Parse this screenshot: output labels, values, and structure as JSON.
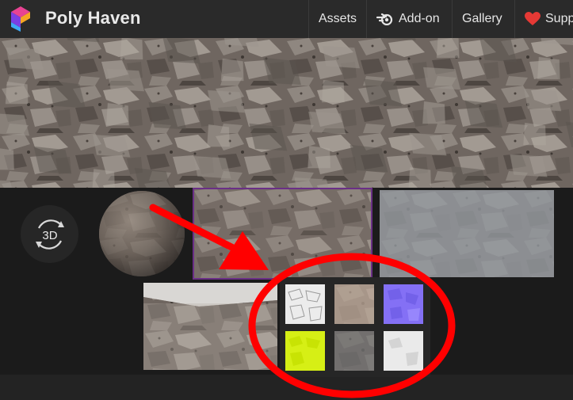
{
  "header": {
    "brand": "Poly Haven",
    "nav": [
      {
        "label": "Assets",
        "icon": ""
      },
      {
        "label": "Add-on",
        "icon": "blender-icon"
      },
      {
        "label": "Gallery",
        "icon": ""
      },
      {
        "label": "Supp",
        "icon": "heart-icon"
      }
    ]
  },
  "preview": {
    "button_label": "3D",
    "maps": [
      "diffuse-map",
      "albedo-map",
      "normal-map",
      "roughness-map",
      "displacement-map",
      "ao-map"
    ]
  },
  "colors": {
    "accent_outline": "#6a2f86",
    "annotation_red": "#ff0000",
    "heart": "#e53935"
  }
}
